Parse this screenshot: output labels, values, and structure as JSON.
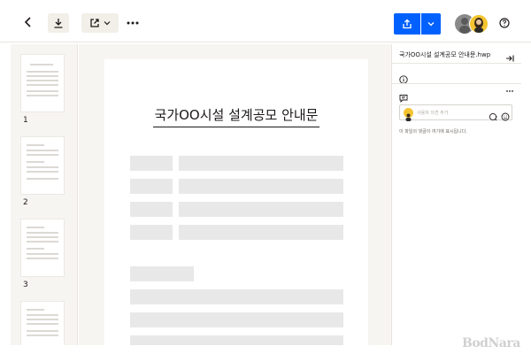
{
  "toolbar": {
    "back_icon": "chevron-left-icon",
    "download_icon": "download-icon",
    "open_icon": "open-external-icon",
    "more_icon": "more-horizontal-icon",
    "share_icon": "share-icon",
    "help_icon": "help-icon",
    "share_color": "#0061fe"
  },
  "thumbnails": [
    {
      "label": "1"
    },
    {
      "label": "2"
    },
    {
      "label": "3"
    }
  ],
  "document": {
    "title": "국가OO시설 설계공모 안내문"
  },
  "panel": {
    "file_name": "국가OO시설 설계공모 안내문.hwp",
    "comment_placeholder": "사용자 의견 추가",
    "empty_message": "이 파일의 댓글이 여기에 표시됩니다."
  },
  "watermark": {
    "text": "BodNara"
  }
}
